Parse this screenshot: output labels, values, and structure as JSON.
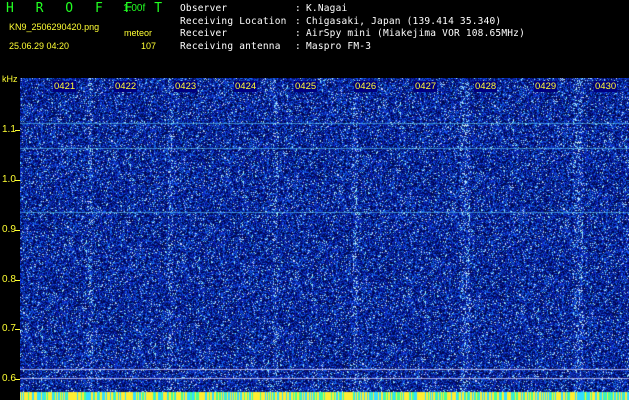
{
  "header": {
    "logo": "H R O F F T",
    "version": "1.00f",
    "filename": "KN9_2506290420.png",
    "meteor_label": "meteor",
    "datetime": "25.06.29 04:20",
    "count": "107",
    "info": [
      {
        "key": "Observer",
        "value": "K.Nagai"
      },
      {
        "key": "Receiving Location",
        "value": "Chigasaki, Japan (139.414 35.340)"
      },
      {
        "key": "Receiver",
        "value": "AirSpy mini (Miakejima VOR 108.65MHz)"
      },
      {
        "key": "Receiving antenna",
        "value": "Maspro FM-3"
      }
    ],
    "separator": ":"
  },
  "spectrogram": {
    "y_unit": "kHz",
    "y_ticks": [
      "1.1",
      "1.0",
      "0.9",
      "0.8",
      "0.7",
      "0.6"
    ],
    "x_labels": [
      "0421",
      "0422",
      "0423",
      "0424",
      "0425",
      "0426",
      "0427",
      "0428",
      "0429",
      "0430"
    ]
  }
}
